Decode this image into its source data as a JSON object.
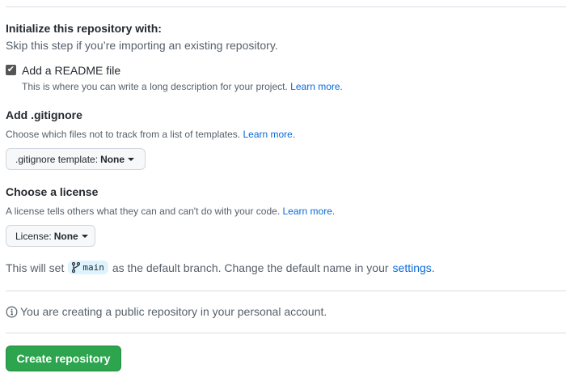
{
  "init": {
    "title": "Initialize this repository with:",
    "subtitle": "Skip this step if you’re importing an existing repository."
  },
  "readme": {
    "label": "Add a README file",
    "checked": true,
    "description": "This is where you can write a long description for your project.",
    "learn_more": "Learn more."
  },
  "gitignore": {
    "title": "Add .gitignore",
    "description": "Choose which files not to track from a list of templates.",
    "learn_more": "Learn more.",
    "button_label": ".gitignore template:",
    "button_value": "None"
  },
  "license": {
    "title": "Choose a license",
    "description": "A license tells others what they can and can't do with your code.",
    "learn_more": "Learn more.",
    "button_label": "License:",
    "button_value": "None"
  },
  "branch": {
    "prefix": "This will set",
    "name": "main",
    "suffix": "as the default branch. Change the default name in your",
    "link": "settings",
    "end": "."
  },
  "info": {
    "text": "You are creating a public repository in your personal account."
  },
  "create_button": "Create repository"
}
